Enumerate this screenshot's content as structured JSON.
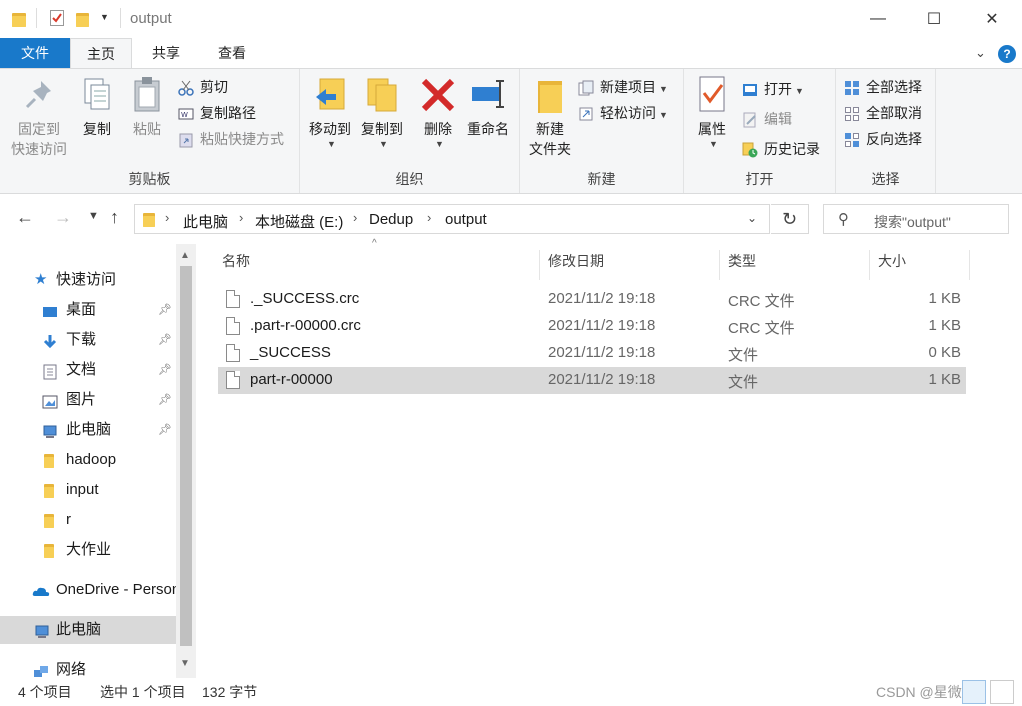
{
  "window": {
    "title": "output",
    "minimize": "—",
    "maximize": "☐",
    "close": "✕"
  },
  "tabs": {
    "file": "文件",
    "home": "主页",
    "share": "共享",
    "view": "查看"
  },
  "ribbon": {
    "clipboard": {
      "label": "剪贴板",
      "pin_line1": "固定到",
      "pin_line2": "快速访问",
      "copy": "复制",
      "paste": "粘贴",
      "cut": "剪切",
      "copy_path": "复制路径",
      "paste_shortcut": "粘贴快捷方式"
    },
    "organize": {
      "label": "组织",
      "move_to": "移动到",
      "copy_to": "复制到",
      "delete": "删除",
      "rename": "重命名"
    },
    "new": {
      "label": "新建",
      "new_folder_line1": "新建",
      "new_folder_line2": "文件夹",
      "new_item": "新建项目",
      "easy_access": "轻松访问"
    },
    "open": {
      "label": "打开",
      "properties": "属性",
      "open": "打开",
      "edit": "编辑",
      "history": "历史记录"
    },
    "select": {
      "label": "选择",
      "select_all": "全部选择",
      "select_none": "全部取消",
      "invert": "反向选择"
    }
  },
  "address": {
    "crumbs": [
      "此电脑",
      "本地磁盘 (E:)",
      "Dedup",
      "output"
    ],
    "search_placeholder": "搜索\"output\""
  },
  "nav": {
    "quick_access": "快速访问",
    "items": [
      {
        "label": "桌面",
        "icon": "desktop-icon",
        "pinned": true
      },
      {
        "label": "下载",
        "icon": "download-icon",
        "pinned": true
      },
      {
        "label": "文档",
        "icon": "documents-icon",
        "pinned": true
      },
      {
        "label": "图片",
        "icon": "pictures-icon",
        "pinned": true
      },
      {
        "label": "此电脑",
        "icon": "computer-icon",
        "pinned": true
      },
      {
        "label": "hadoop",
        "icon": "folder-icon",
        "pinned": false
      },
      {
        "label": "input",
        "icon": "folder-icon",
        "pinned": false
      },
      {
        "label": "r",
        "icon": "folder-icon",
        "pinned": false
      },
      {
        "label": "大作业",
        "icon": "folder-icon",
        "pinned": false
      }
    ],
    "onedrive": "OneDrive - Personal",
    "this_pc": "此电脑",
    "network": "网络"
  },
  "columns": {
    "name": "名称",
    "modified": "修改日期",
    "type": "类型",
    "size": "大小"
  },
  "files": [
    {
      "name": "._SUCCESS.crc",
      "modified": "2021/11/2 19:18",
      "type": "CRC 文件",
      "size": "1 KB"
    },
    {
      "name": ".part-r-00000.crc",
      "modified": "2021/11/2 19:18",
      "type": "CRC 文件",
      "size": "1 KB"
    },
    {
      "name": "_SUCCESS",
      "modified": "2021/11/2 19:18",
      "type": "文件",
      "size": "0 KB"
    },
    {
      "name": "part-r-00000",
      "modified": "2021/11/2 19:18",
      "type": "文件",
      "size": "1 KB"
    }
  ],
  "status": {
    "item_count": "4 个项目",
    "selection": "选中 1 个项目",
    "selection_size": "132 字节"
  },
  "watermark": "CSDN @星微玲",
  "colors": {
    "accent": "#1979ca",
    "selection": "#d9d9d9",
    "folder": "#f7cf56"
  }
}
